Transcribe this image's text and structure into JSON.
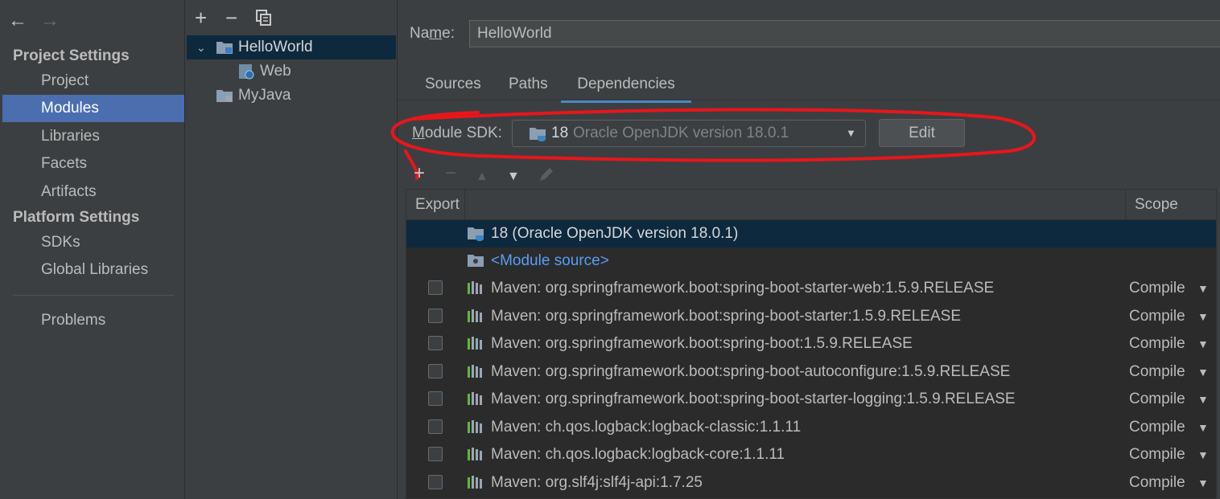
{
  "nav": {
    "project_settings": "Project Settings",
    "project_items": [
      "Project",
      "Modules",
      "Libraries",
      "Facets",
      "Artifacts"
    ],
    "platform_settings": "Platform Settings",
    "platform_items": [
      "SDKs",
      "Global Libraries"
    ],
    "problems": "Problems",
    "selected": "Modules"
  },
  "tree": {
    "nodes": [
      {
        "label": "HelloWorld",
        "expanded": true,
        "selected": true
      },
      {
        "label": "Web"
      },
      {
        "label": "MyJava"
      }
    ]
  },
  "module": {
    "name_label": "Name:",
    "name_value": "HelloWorld",
    "tabs": [
      "Sources",
      "Paths",
      "Dependencies"
    ],
    "active_tab": "Dependencies",
    "sdk_label": "Module SDK:",
    "sdk_version": "18",
    "sdk_desc": "Oracle OpenJDK version 18.0.1",
    "edit_label": "Edit"
  },
  "dependencies": {
    "col_export": "Export",
    "col_scope": "Scope",
    "jdk_row": "18 (Oracle OpenJDK version 18.0.1)",
    "module_source": "<Module source>",
    "libs": [
      {
        "name": "Maven: org.springframework.boot:spring-boot-starter-web:1.5.9.RELEASE",
        "scope": "Compile"
      },
      {
        "name": "Maven: org.springframework.boot:spring-boot-starter:1.5.9.RELEASE",
        "scope": "Compile"
      },
      {
        "name": "Maven: org.springframework.boot:spring-boot:1.5.9.RELEASE",
        "scope": "Compile"
      },
      {
        "name": "Maven: org.springframework.boot:spring-boot-autoconfigure:1.5.9.RELEASE",
        "scope": "Compile"
      },
      {
        "name": "Maven: org.springframework.boot:spring-boot-starter-logging:1.5.9.RELEASE",
        "scope": "Compile"
      },
      {
        "name": "Maven: ch.qos.logback:logback-classic:1.1.11",
        "scope": "Compile"
      },
      {
        "name": "Maven: ch.qos.logback:logback-core:1.1.11",
        "scope": "Compile"
      },
      {
        "name": "Maven: org.slf4j:slf4j-api:1.7.25",
        "scope": "Compile"
      }
    ]
  },
  "colors": {
    "background": "#3c3f41",
    "table_bg": "#2b2b2b",
    "selection": "#4b6eaf",
    "tree_selection": "#0d293e",
    "link": "#589df6",
    "annotation": "#e8161b"
  },
  "icons": [
    "back-arrow-icon",
    "forward-arrow-icon",
    "add-icon",
    "remove-icon",
    "copy-icon",
    "folder-module-icon",
    "web-icon",
    "jdk-folder-icon",
    "source-folder-icon",
    "maven-library-icon",
    "move-up-icon",
    "move-down-icon",
    "edit-pencil-icon",
    "dropdown-arrow-icon"
  ]
}
